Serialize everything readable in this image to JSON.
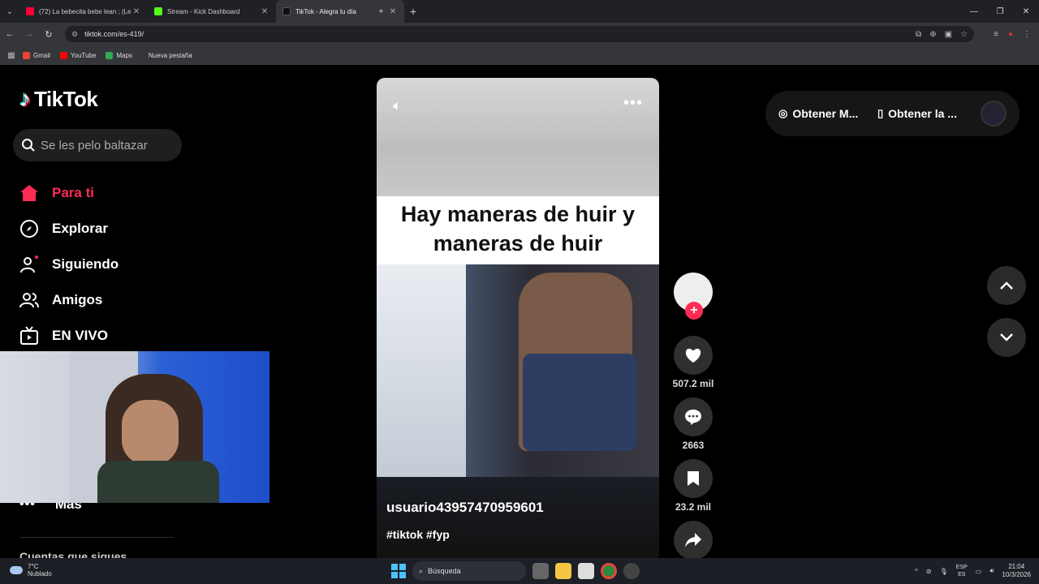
{
  "browser": {
    "tabs": [
      {
        "title": "(72) La bebecita bebe lean ; (Le",
        "favicon_color": "#ff0033",
        "active": false
      },
      {
        "title": "Stream - Kick Dashboard",
        "favicon_color": "#53fc18",
        "active": false
      },
      {
        "title": "TikTok - Alegra tu día",
        "favicon_color": "#000000",
        "active": true
      }
    ],
    "url": "tiktok.com/es-419/",
    "bookmarks": [
      {
        "label": "Gmail",
        "color": "#ea4335"
      },
      {
        "label": "YouTube",
        "color": "#ff0000"
      },
      {
        "label": "Maps",
        "color": "#34a853"
      },
      {
        "label": "Nueva pestaña",
        "color": ""
      }
    ]
  },
  "tiktok": {
    "logo": "TikTok",
    "search_placeholder": "Se les pelo baltazar",
    "nav": [
      {
        "label": "Para ti",
        "icon": "home-icon",
        "active": true
      },
      {
        "label": "Explorar",
        "icon": "compass-icon",
        "active": false
      },
      {
        "label": "Siguiendo",
        "icon": "following-icon",
        "active": false
      },
      {
        "label": "Amigos",
        "icon": "friends-icon",
        "active": false
      },
      {
        "label": "EN VIVO",
        "icon": "live-icon",
        "active": false
      }
    ],
    "more_label": "Más",
    "following_title": "Cuentas que sigues",
    "accent": "#fe2c55",
    "header": {
      "get_app_1": "Obtener M...",
      "get_app_2": "Obtener la ..."
    },
    "video": {
      "caption_line1": "Hay maneras de huir y",
      "caption_line2": "maneras de huir",
      "author": "usuario43957470959601",
      "tags": "#tiktok #fyp"
    },
    "actions": {
      "likes": "507.2 mil",
      "comments": "2663",
      "saves": "23.2 mil"
    }
  },
  "taskbar": {
    "temp": "7°C",
    "weather": "Nublado",
    "search": "Búsqueda",
    "lang1": "ESP",
    "lang2": "ES",
    "time": "21:04",
    "date": "10/3/2026"
  }
}
